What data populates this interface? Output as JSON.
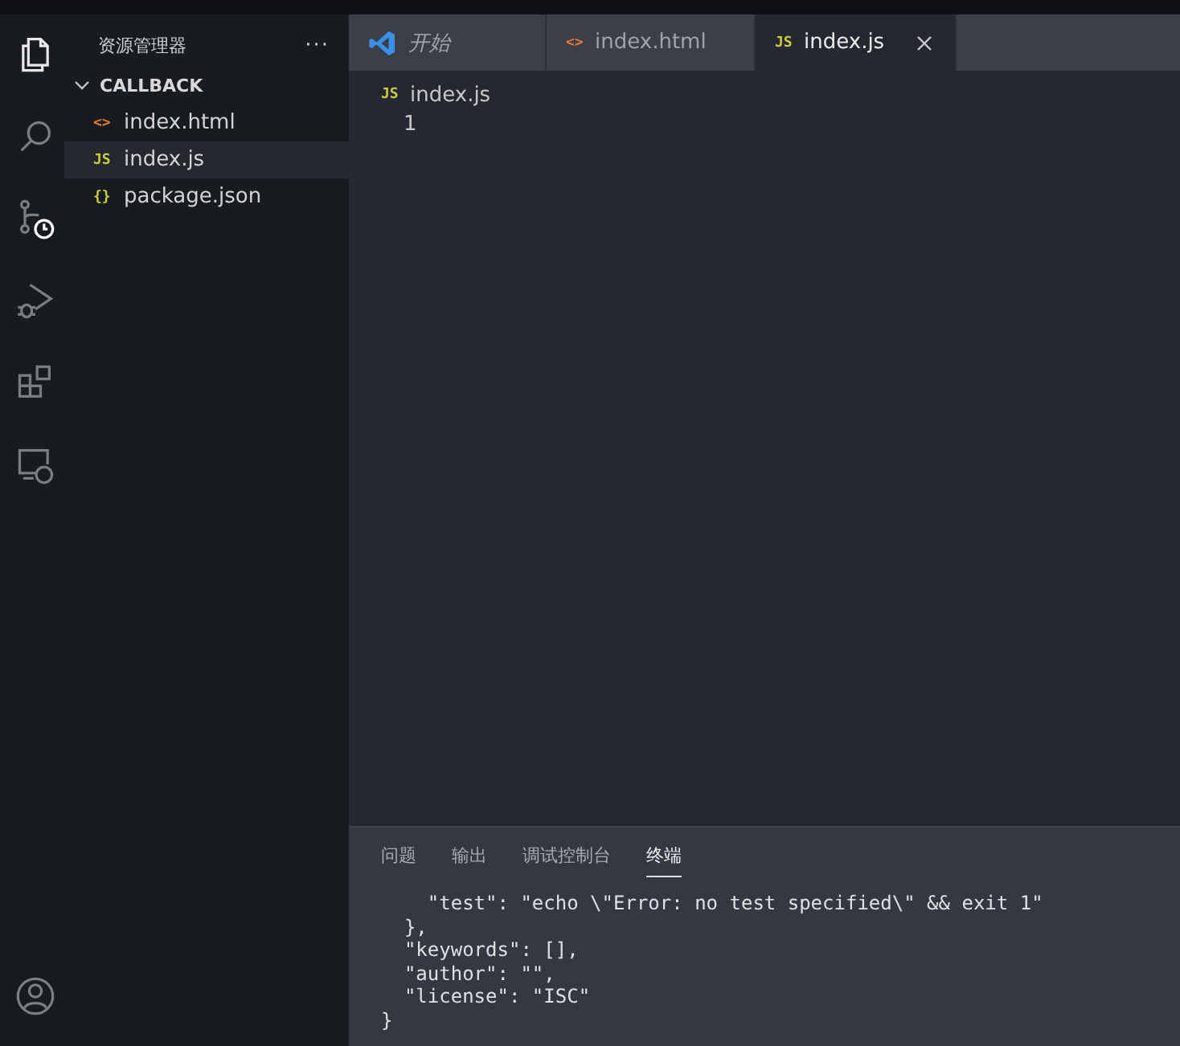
{
  "activity_bar": [
    {
      "kind": "files",
      "selected": true
    },
    {
      "kind": "search",
      "selected": false
    },
    {
      "kind": "scm",
      "selected": false
    },
    {
      "kind": "debug",
      "selected": false
    },
    {
      "kind": "extensions",
      "selected": false
    },
    {
      "kind": "remote",
      "selected": false
    }
  ],
  "account": {
    "kind": "account"
  },
  "sidebar": {
    "title": "资源管理器",
    "more": "···",
    "folder": {
      "name": "CALLBACK",
      "expanded": true,
      "files": [
        {
          "name": "index.html",
          "kind": "html",
          "icon": "<>",
          "selected": false
        },
        {
          "name": "index.js",
          "kind": "js",
          "icon": "JS",
          "selected": true
        },
        {
          "name": "package.json",
          "kind": "json",
          "icon": "{}",
          "selected": false
        }
      ]
    }
  },
  "tabs": [
    {
      "label": "开始",
      "kind": "welcome",
      "selected": false,
      "preview": true
    },
    {
      "label": "index.html",
      "kind": "html",
      "icon": "<>",
      "selected": false,
      "preview": false
    },
    {
      "label": "index.js",
      "kind": "js",
      "icon": "JS",
      "selected": true,
      "preview": false
    }
  ],
  "breadcrumb": {
    "label": "index.js",
    "kind": "js",
    "icon": "JS"
  },
  "editor": {
    "line_numbers": [
      "1"
    ]
  },
  "panel": {
    "tabs": [
      {
        "label": "问题",
        "selected": false
      },
      {
        "label": "输出",
        "selected": false
      },
      {
        "label": "调试控制台",
        "selected": false
      },
      {
        "label": "终端",
        "selected": true
      }
    ],
    "terminal_lines": [
      "    \"test\": \"echo \\\"Error: no test specified\\\" && exit 1\"",
      "  },",
      "  \"keywords\": [],",
      "  \"author\": \"\",",
      "  \"license\": \"ISC\"",
      "}"
    ]
  }
}
